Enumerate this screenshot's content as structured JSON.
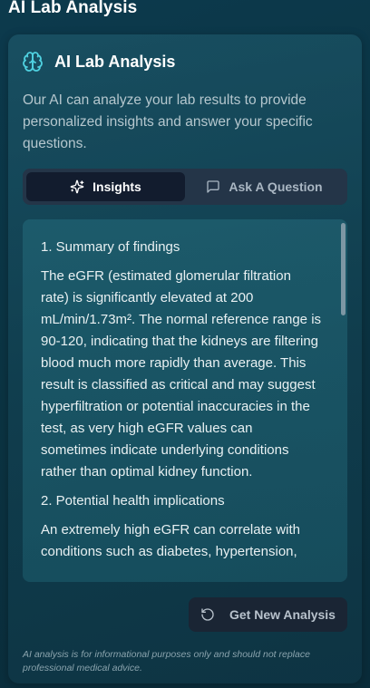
{
  "page": {
    "title": "AI Lab Analysis"
  },
  "card": {
    "icon": "brain-icon",
    "title": "AI Lab Analysis",
    "description": "Our AI can analyze your lab results to provide personalized insights and answer your specific questions."
  },
  "tabs": [
    {
      "label": "Insights",
      "icon": "sparkles-icon",
      "active": true
    },
    {
      "label": "Ask A Question",
      "icon": "message-square-icon",
      "active": false
    }
  ],
  "analysis": {
    "sections": [
      {
        "heading": "1. Summary of findings",
        "body": "The eGFR (estimated glomerular filtration rate) is significantly elevated at 200 mL/min/1.73m². The normal reference range is 90-120, indicating that the kidneys are filtering blood much more rapidly than average. This result is classified as critical and may suggest hyperfiltration or potential inaccuracies in the test, as very high eGFR values can sometimes indicate underlying conditions rather than optimal kidney function."
      },
      {
        "heading": "2. Potential health implications",
        "body": "An extremely high eGFR can correlate with conditions such as diabetes, hypertension,"
      }
    ]
  },
  "actions": {
    "new_analysis_label": "Get New Analysis",
    "new_analysis_icon": "rotate-ccw-icon"
  },
  "disclaimer": "AI analysis is for informational purposes only and should not replace professional medical advice.",
  "colors": {
    "background": "#0b3443",
    "accent": "#4fd1e0",
    "tab_active_bg": "#121c2e",
    "tab_bar_bg": "#243548",
    "button_bg": "#1a2534"
  }
}
